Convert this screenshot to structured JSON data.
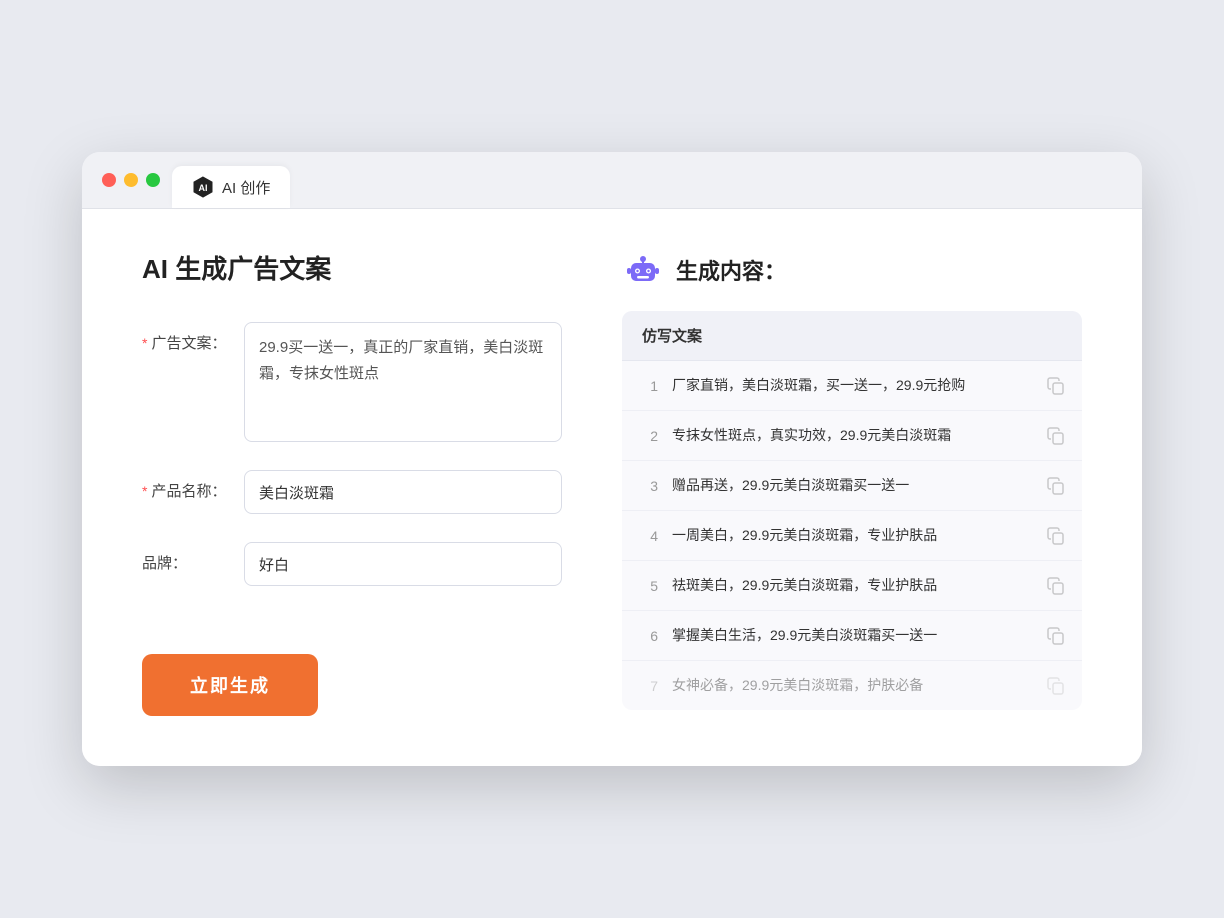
{
  "browser": {
    "tab_label": "AI 创作"
  },
  "page": {
    "title": "AI 生成广告文案",
    "right_title": "生成内容："
  },
  "form": {
    "ad_copy_label": "广告文案：",
    "ad_copy_required": true,
    "ad_copy_value": "29.9买一送一，真正的厂家直销，美白淡斑霜，专抹女性斑点",
    "product_name_label": "产品名称：",
    "product_name_required": true,
    "product_name_value": "美白淡斑霜",
    "brand_label": "品牌：",
    "brand_required": false,
    "brand_value": "好白",
    "generate_button": "立即生成"
  },
  "results": {
    "column_label": "仿写文案",
    "items": [
      {
        "num": "1",
        "text": "厂家直销，美白淡斑霜，买一送一，29.9元抢购",
        "dimmed": false
      },
      {
        "num": "2",
        "text": "专抹女性斑点，真实功效，29.9元美白淡斑霜",
        "dimmed": false
      },
      {
        "num": "3",
        "text": "赠品再送，29.9元美白淡斑霜买一送一",
        "dimmed": false
      },
      {
        "num": "4",
        "text": "一周美白，29.9元美白淡斑霜，专业护肤品",
        "dimmed": false
      },
      {
        "num": "5",
        "text": "祛斑美白，29.9元美白淡斑霜，专业护肤品",
        "dimmed": false
      },
      {
        "num": "6",
        "text": "掌握美白生活，29.9元美白淡斑霜买一送一",
        "dimmed": false
      },
      {
        "num": "7",
        "text": "女神必备，29.9元美白淡斑霜，护肤必备",
        "dimmed": true
      }
    ]
  }
}
